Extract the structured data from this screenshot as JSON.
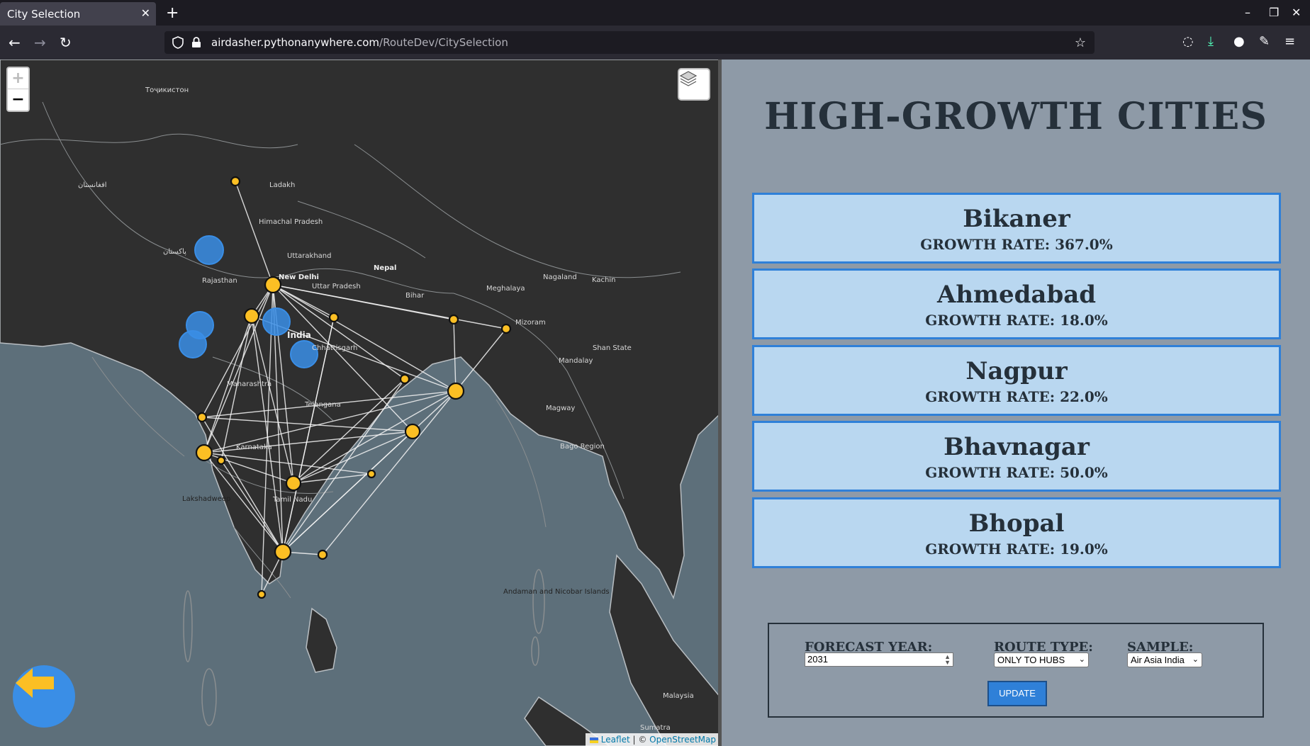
{
  "browser": {
    "tab_title": "City Selection",
    "tab_close": "✕",
    "new_tab": "+",
    "url_host": "airdasher.pythonanywhere.com",
    "url_path": "/RouteDev/CitySelection",
    "window_controls": [
      "–",
      "❐",
      "✕"
    ]
  },
  "map": {
    "zoom_in": "+",
    "zoom_out": "−",
    "attribution_leaflet": "Leaflet",
    "attribution_sep": " | © ",
    "attribution_osm": "OpenStreetMap",
    "labels": [
      {
        "text": "Тоҷикистон"
      },
      {
        "text": "Ladakh"
      },
      {
        "text": "Himachal Pradesh"
      },
      {
        "text": "Uttarakhand"
      },
      {
        "text": "New Delhi"
      },
      {
        "text": "Nepal"
      },
      {
        "text": "Rajasthan"
      },
      {
        "text": "Uttar Pradesh"
      },
      {
        "text": "Bihar"
      },
      {
        "text": "India"
      },
      {
        "text": "Chhattisgarh"
      },
      {
        "text": "Maharashtra"
      },
      {
        "text": "Telangana"
      },
      {
        "text": "Karnataka"
      },
      {
        "text": "Tamil Nadu"
      },
      {
        "text": "Lakshadweep"
      },
      {
        "text": "Meghalaya"
      },
      {
        "text": "Mizoram"
      },
      {
        "text": "Nagaland"
      },
      {
        "text": "Shan State"
      },
      {
        "text": "Mandalay"
      },
      {
        "text": "Magway"
      },
      {
        "text": "Bago Region"
      },
      {
        "text": "Andaman and Nicobar Islands"
      },
      {
        "text": "Malaysia"
      },
      {
        "text": "Sumatra"
      },
      {
        "text": "Kachin"
      },
      {
        "text": "پاکستان"
      },
      {
        "text": "افغانستان"
      }
    ]
  },
  "panel": {
    "title": "HIGH-GROWTH CITIES",
    "cities": [
      {
        "name": "Bikaner",
        "rate": "GROWTH RATE: 367.0%"
      },
      {
        "name": "Ahmedabad",
        "rate": "GROWTH RATE: 18.0%"
      },
      {
        "name": "Nagpur",
        "rate": "GROWTH RATE: 22.0%"
      },
      {
        "name": "Bhavnagar",
        "rate": "GROWTH RATE: 50.0%"
      },
      {
        "name": "Bhopal",
        "rate": "GROWTH RATE: 19.0%"
      }
    ],
    "controls": {
      "forecast_label": "FORECAST YEAR:",
      "forecast_value": "2031",
      "route_label": "ROUTE TYPE:",
      "route_value": "ONLY TO HUBS",
      "sample_label": "SAMPLE:",
      "sample_value": "Air Asia India",
      "update_label": "UPDATE"
    }
  },
  "colors": {
    "panel_bg": "#8e9aa7",
    "card_bg": "#b9d7f0",
    "card_border": "#2f80d8",
    "hub_marker": "#fbbf24",
    "growth_marker": "#3a8ee6"
  }
}
